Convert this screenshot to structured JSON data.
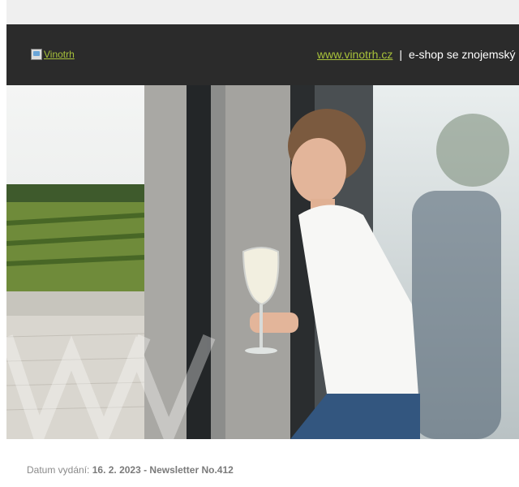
{
  "header": {
    "logo_alt": "Vinotrh",
    "site_link": "www.vinotrh.cz",
    "separator": "|",
    "tagline": "e-shop se znojemský"
  },
  "meta": {
    "date_label": "Datum vydání:",
    "date_value": "16. 2. 2023 - Newsletter No.412"
  },
  "colors": {
    "header_bg": "#2b2b2b",
    "accent": "#a8c23a"
  }
}
